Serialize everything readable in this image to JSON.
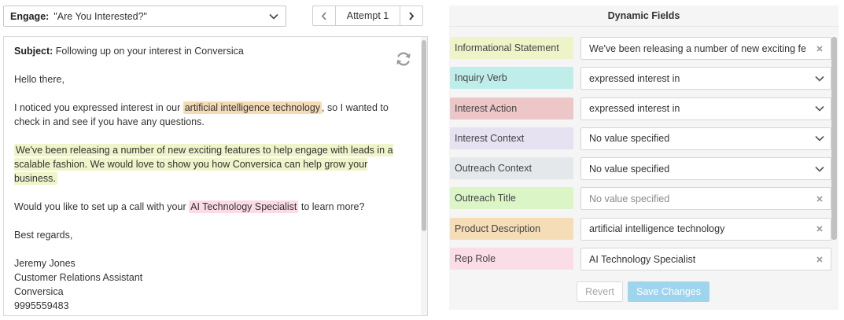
{
  "engage": {
    "label": "Engage:",
    "value": "\"Are You Interested?\"",
    "icon": "chevron-down-icon"
  },
  "attempt": {
    "label": "Attempt 1",
    "prev_icon": "chevron-left-icon",
    "next_icon": "chevron-right-icon"
  },
  "email": {
    "subject_label": "Subject:",
    "subject": "Following up on your interest in Conversica",
    "greeting": "Hello there,",
    "p1_before": "I noticed you expressed interest in our ",
    "p1_highlight": "artificial intelligence technology",
    "p1_after": ", so I wanted to check in and see if you have any questions.",
    "p2_highlight": "We've been releasing a number of new exciting features to help engage with leads in a scalable fashion. We would love to show you how Conversica can help grow your business.",
    "p3_before": "Would you like to set up a call with your ",
    "p3_highlight": "AI Technology Specialist",
    "p3_after": " to learn more?",
    "closing": "Best regards,",
    "sig_name": "Jeremy Jones",
    "sig_title": "Customer Relations Assistant",
    "sig_company": "Conversica",
    "sig_phone": "9995559483",
    "refresh_icon": "refresh-icon"
  },
  "fields": {
    "title": "Dynamic Fields",
    "items": [
      {
        "label": "Informational Statement",
        "value": "We've been releasing a number of new exciting fe",
        "control": "clear",
        "color": "#eef4c8"
      },
      {
        "label": "Inquiry Verb",
        "value": "expressed interest in",
        "control": "dropdown",
        "color": "#bfeeea"
      },
      {
        "label": "Interest Action",
        "value": "expressed interest in",
        "control": "dropdown",
        "color": "#edc7c7"
      },
      {
        "label": "Interest Context",
        "value": "No value specified",
        "control": "dropdown",
        "color": "#e6e2f2"
      },
      {
        "label": "Outreach Context",
        "value": "No value specified",
        "control": "dropdown",
        "color": "#e5e8ea"
      },
      {
        "label": "Outreach Title",
        "value": "No value specified",
        "control": "clear",
        "placeholder": true,
        "color": "#dcf5c6"
      },
      {
        "label": "Product Description",
        "value": "artificial intelligence technology",
        "control": "clear",
        "color": "#f5ddb8"
      },
      {
        "label": "Rep Role",
        "value": "AI Technology Specialist",
        "control": "clear",
        "color": "#fbdde8"
      }
    ],
    "revert_label": "Revert",
    "save_label": "Save Changes"
  },
  "colors": {
    "highlight_product": "#f5dbb5",
    "highlight_info": "#eff4c9",
    "highlight_rep": "#fbdbe6",
    "save_button": "#9fd4ee"
  }
}
